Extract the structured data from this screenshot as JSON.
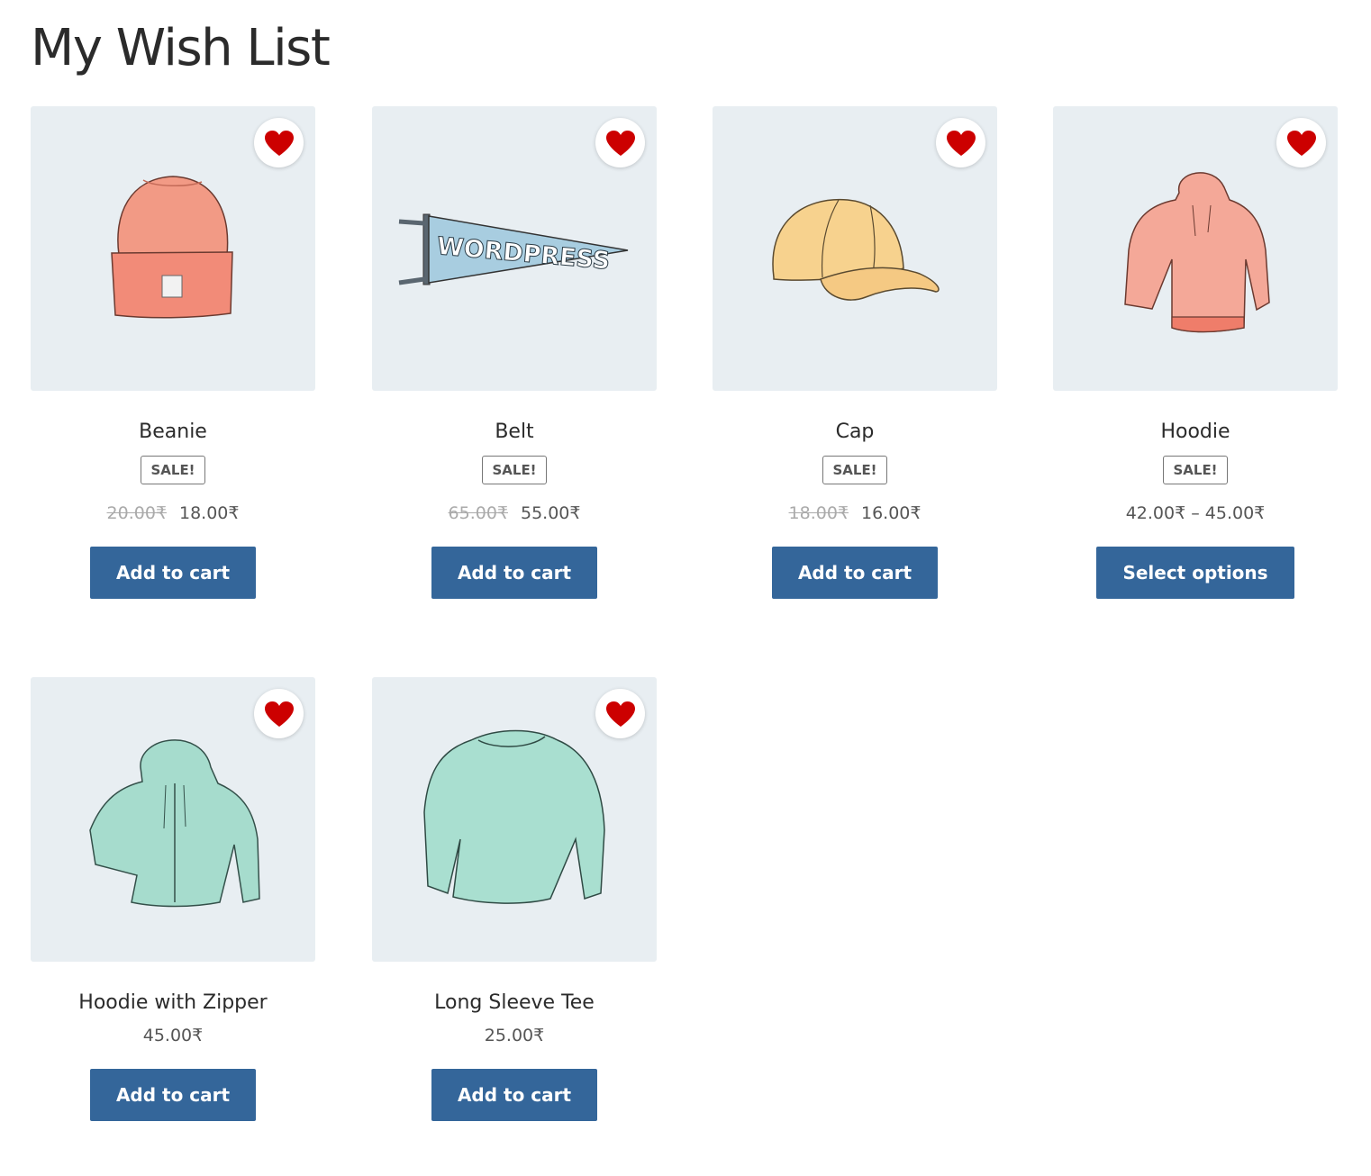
{
  "page": {
    "title": "My Wish List"
  },
  "colors": {
    "accent_button": "#34669a",
    "heart": "#cc0000",
    "thumb_bg": "#e8eef2"
  },
  "products": [
    {
      "name": "Beanie",
      "badge": "SALE!",
      "old_price": "20.00₹",
      "price": "18.00₹",
      "button": "Add to cart",
      "icon": "beanie-illustration"
    },
    {
      "name": "Belt",
      "badge": "SALE!",
      "old_price": "65.00₹",
      "price": "55.00₹",
      "button": "Add to cart",
      "icon": "pennant-illustration",
      "pennant_text": "WORDPRESS"
    },
    {
      "name": "Cap",
      "badge": "SALE!",
      "old_price": "18.00₹",
      "price": "16.00₹",
      "button": "Add to cart",
      "icon": "cap-illustration"
    },
    {
      "name": "Hoodie",
      "badge": "SALE!",
      "old_price": "",
      "price": "42.00₹ – 45.00₹",
      "button": "Select options",
      "icon": "hoodie-illustration"
    },
    {
      "name": "Hoodie with Zipper",
      "badge": "",
      "old_price": "",
      "price": "45.00₹",
      "button": "Add to cart",
      "icon": "zip-hoodie-illustration"
    },
    {
      "name": "Long Sleeve Tee",
      "badge": "",
      "old_price": "",
      "price": "25.00₹",
      "button": "Add to cart",
      "icon": "long-sleeve-tee-illustration"
    }
  ]
}
